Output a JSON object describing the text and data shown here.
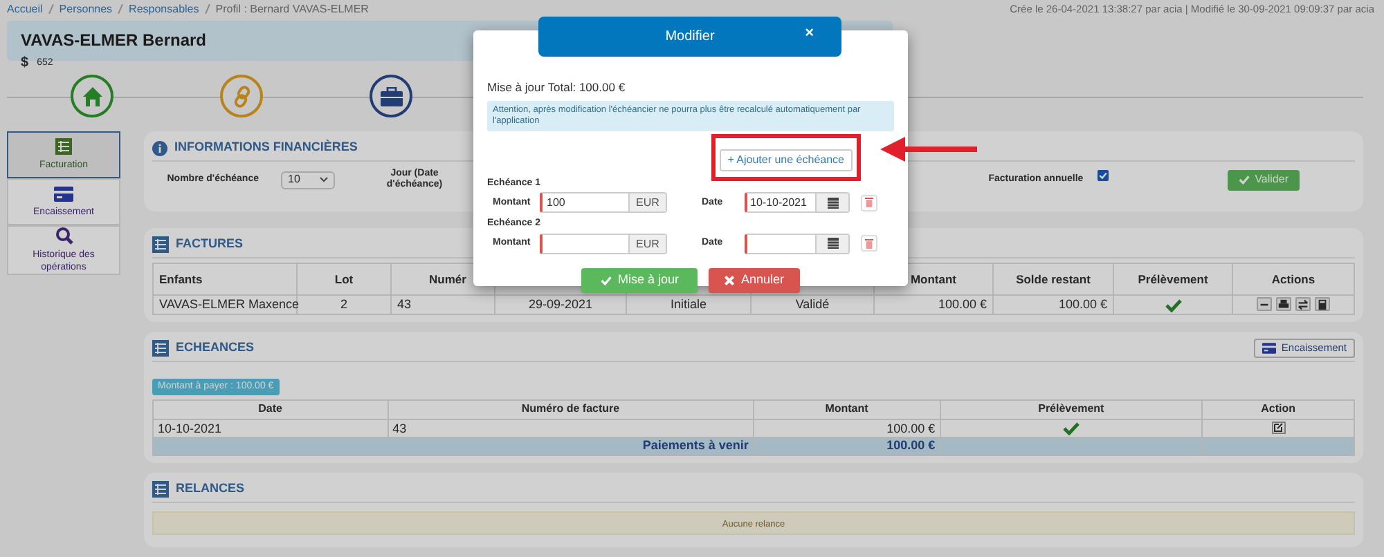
{
  "breadcrumb": [
    "Accueil",
    "Personnes",
    "Responsables",
    "Profil : Bernard VAVAS-ELMER"
  ],
  "meta": "Crée le 26-04-2021 13:38:27 par acia | Modifié le 30-09-2021 09:09:37 par acia",
  "profile": {
    "name": "VAVAS-ELMER Bernard",
    "currency_symbol": "$",
    "number": "652"
  },
  "steps": [
    {
      "kind": "home"
    },
    {
      "kind": "link"
    },
    {
      "kind": "briefcase"
    }
  ],
  "sidebar": {
    "items": [
      {
        "kind": "list",
        "label": "Facturation",
        "selected": true
      },
      {
        "kind": "card",
        "label": "Encaissement",
        "selected": false
      },
      {
        "kind": "search",
        "label": "Historique des opérations",
        "selected": false
      }
    ]
  },
  "info": {
    "title": "INFORMATIONS FINANCIÈRES",
    "count_label": "Nombre d'échéance",
    "count_value": "10",
    "day_label": "Jour (Date d'échéance)",
    "annual_label": "Facturation annuelle",
    "annual_checked": true,
    "submit": "Valider"
  },
  "factures": {
    "title": "FACTURES",
    "columns": [
      {
        "label": "Enfants"
      },
      {
        "label": "Lot"
      },
      {
        "label": "Numér"
      },
      {},
      {},
      {},
      {
        "label": "Montant"
      },
      {
        "label": "Solde restant"
      },
      {
        "label": "Prélèvement"
      },
      {
        "label": "Actions"
      }
    ],
    "rows": [
      {
        "cells": [
          "VAVAS-ELMER Maxence",
          "2",
          "43",
          "29-09-2021",
          "Initiale",
          "Validé",
          "100.00 €",
          "100.00 €"
        ],
        "prelevement": true
      }
    ]
  },
  "echeances": {
    "title": "ECHEANCES",
    "button": "Encaissement",
    "badge": "Montant à payer : 100.00 €",
    "columns": [
      "Date",
      "Numéro de facture",
      "Montant",
      "Prélèvement",
      "Action"
    ],
    "rows": [
      {
        "cells": [
          "10-10-2021",
          "43",
          "100.00 €"
        ],
        "prelevement": true
      }
    ],
    "footer": {
      "label": "Paiements à venir",
      "total": "100.00 €"
    }
  },
  "relances": {
    "title": "RELANCES",
    "empty": "Aucune relance"
  },
  "modal": {
    "title": "Modifier",
    "close": "×",
    "total": "Mise à jour Total: 100.00 €",
    "warning": "Attention, après modification l'échéancier ne pourra plus être recalculé automatiquement par l'application",
    "add": "+ Ajouter une échéance",
    "echeances": [
      {
        "title": "Echéance 1",
        "amount_label": "Montant",
        "amount": "100",
        "currency": "EUR",
        "date_label": "Date",
        "date": "10-10-2021"
      },
      {
        "title": "Echéance 2",
        "amount_label": "Montant",
        "currency": "EUR",
        "date_label": "Date"
      }
    ],
    "save": "Mise à jour",
    "cancel": "Annuler"
  }
}
